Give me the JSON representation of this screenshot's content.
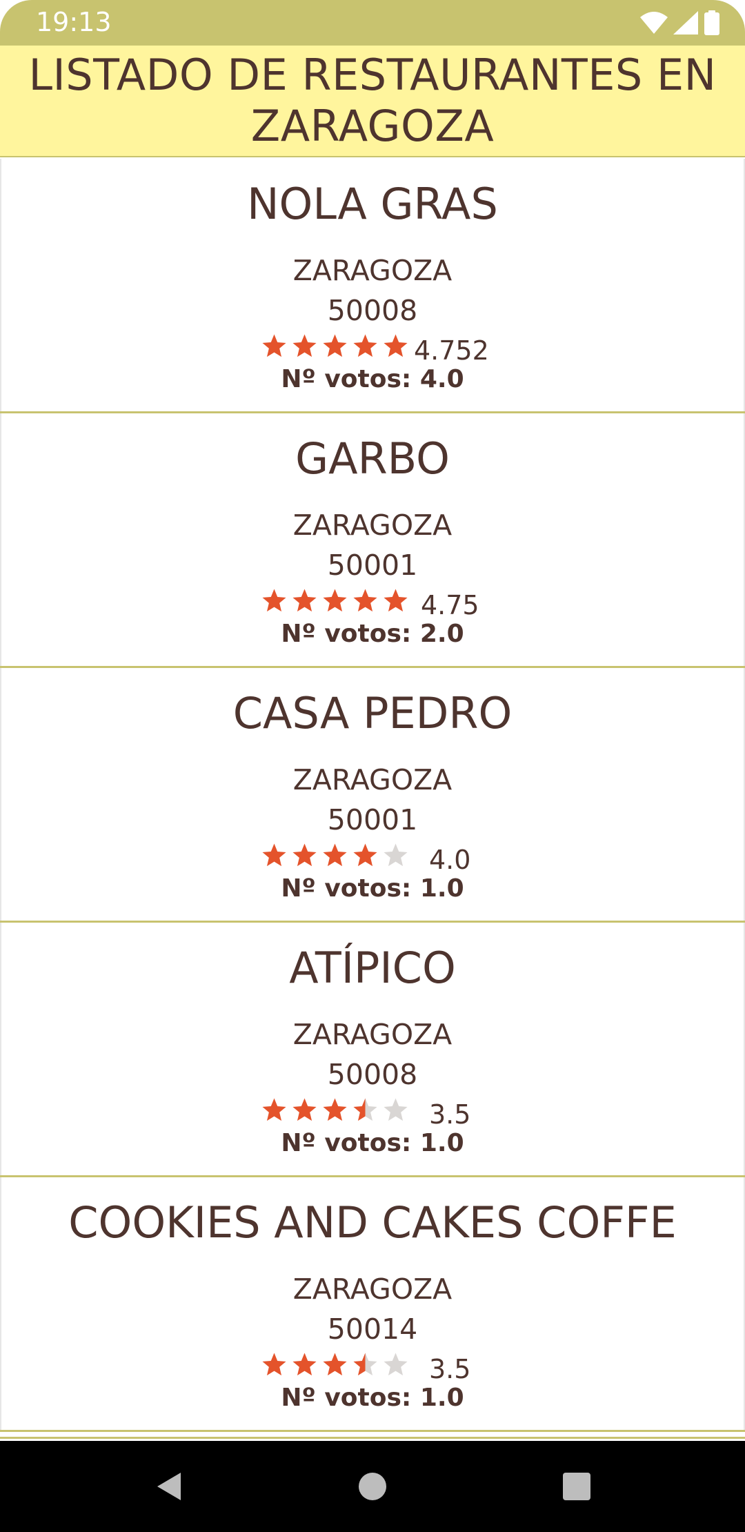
{
  "status_bar": {
    "time": "19:13",
    "icons": [
      "wifi-icon",
      "signal-icon",
      "battery-icon"
    ],
    "color": "#c8c36f"
  },
  "app_bar": {
    "title": "LISTADO DE RESTAURANTES EN ZARAGOZA",
    "background": "#fff59d"
  },
  "colors": {
    "text": "#4e342e",
    "star_filled": "#e4532b",
    "star_empty": "#d9d6d4",
    "divider": "#c8c36f"
  },
  "restaurants": [
    {
      "name": "NOLA GRAS",
      "city": "ZARAGOZA",
      "zip": "50008",
      "stars": 5,
      "rating": "4.752",
      "votes": "Nº votos: 4.0"
    },
    {
      "name": "GARBO",
      "city": "ZARAGOZA",
      "zip": "50001",
      "stars": 5,
      "rating": "4.75",
      "votes": "Nº votos: 2.0"
    },
    {
      "name": "CASA PEDRO",
      "city": "ZARAGOZA",
      "zip": "50001",
      "stars": 4,
      "rating": "4.0",
      "votes": "Nº votos: 1.0"
    },
    {
      "name": "ATÍPICO",
      "city": "ZARAGOZA",
      "zip": "50008",
      "stars": 3.5,
      "rating": "3.5",
      "votes": "Nº votos: 1.0"
    },
    {
      "name": "COOKIES AND CAKES COFFE",
      "city": "ZARAGOZA",
      "zip": "50014",
      "stars": 3.5,
      "rating": "3.5",
      "votes": "Nº votos: 1.0"
    }
  ],
  "nav_bar": {
    "buttons": [
      "back-icon",
      "home-icon",
      "recents-icon"
    ]
  }
}
